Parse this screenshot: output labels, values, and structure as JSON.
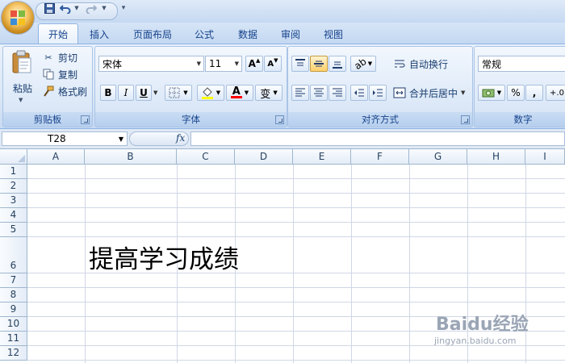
{
  "quick_access": {
    "more": "▾"
  },
  "ribbon_tabs": [
    {
      "label": "开始",
      "active": true
    },
    {
      "label": "插入"
    },
    {
      "label": "页面布局"
    },
    {
      "label": "公式"
    },
    {
      "label": "数据"
    },
    {
      "label": "审阅"
    },
    {
      "label": "视图"
    }
  ],
  "clipboard": {
    "paste_label": "粘贴",
    "cut_label": "剪切",
    "copy_label": "复制",
    "format_painter_label": "格式刷",
    "group_label": "剪贴板"
  },
  "font": {
    "font_name": "宋体",
    "font_size": "11",
    "grow_label": "A",
    "shrink_label": "A",
    "bold": "B",
    "italic": "I",
    "underline": "U",
    "font_color_letter": "A",
    "phonetic_label": "变",
    "group_label": "字体",
    "fill_color": "#ffff00",
    "font_color": "#ff0000"
  },
  "alignment": {
    "wrap_text_label": "自动换行",
    "merge_center_label": "合并后居中",
    "group_label": "对齐方式"
  },
  "number": {
    "format_value": "常规",
    "percent_label": "%",
    "comma_label": ",",
    "decimal_label": "+.0",
    "group_label": "数字"
  },
  "formula_bar": {
    "name_box": "T28",
    "fx_label": "fx",
    "formula": ""
  },
  "sheet": {
    "columns": [
      "A",
      "B",
      "C",
      "D",
      "E",
      "F",
      "G",
      "H",
      "I"
    ],
    "rows": [
      "1",
      "2",
      "3",
      "4",
      "5",
      "6",
      "7",
      "8",
      "9",
      "10",
      "11",
      "12"
    ],
    "cells": [
      {
        "ref": "B6",
        "value": "提高学习成绩"
      }
    ]
  },
  "watermark": {
    "text": "Baidu经验",
    "url": "jingyan.baidu.com"
  }
}
